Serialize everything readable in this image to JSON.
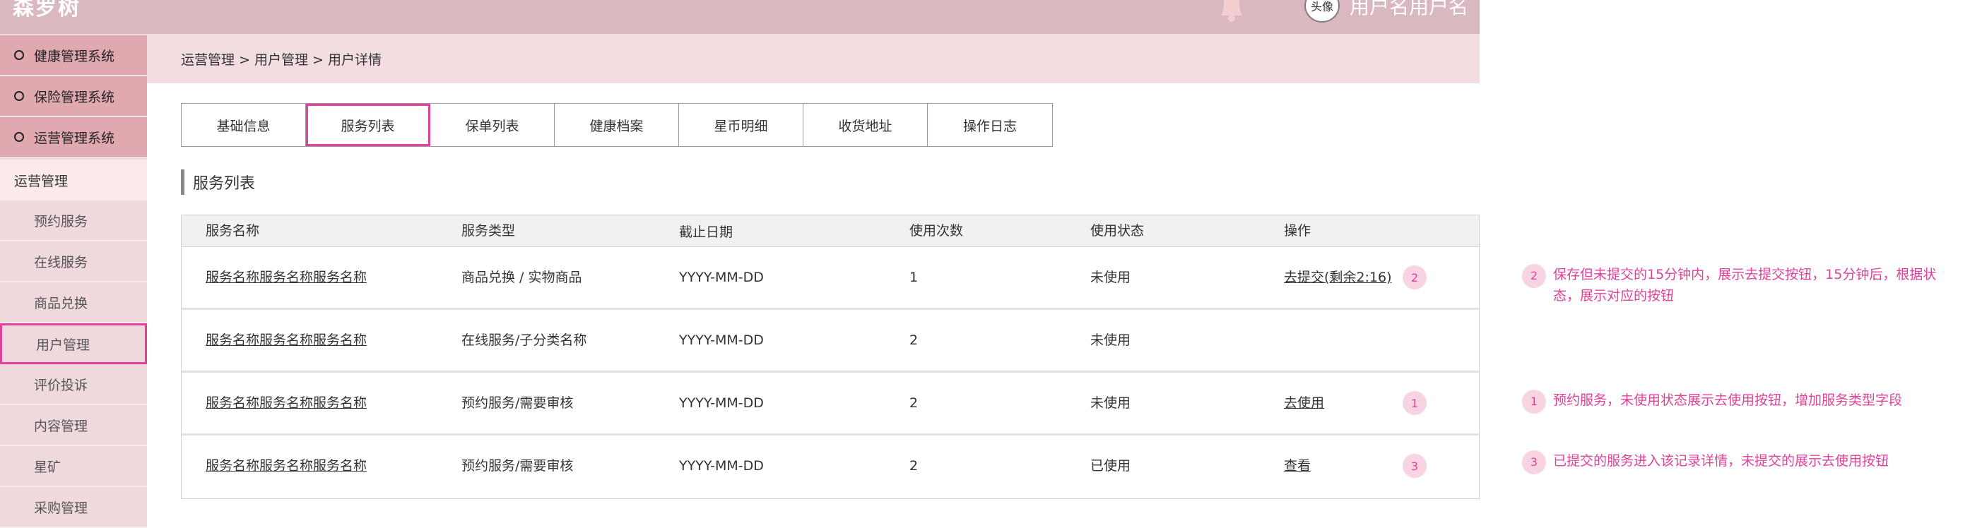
{
  "header": {
    "brand": "森罗树",
    "avatar_label": "头像",
    "username": "用户名用户名"
  },
  "sidebar": {
    "systems": [
      {
        "label": "健康管理系统"
      },
      {
        "label": "保险管理系统"
      },
      {
        "label": "运营管理系统"
      }
    ],
    "section": "运营管理",
    "items": [
      {
        "label": "预约服务"
      },
      {
        "label": "在线服务"
      },
      {
        "label": "商品兑换"
      },
      {
        "label": "用户管理"
      },
      {
        "label": "评价投诉"
      },
      {
        "label": "内容管理"
      },
      {
        "label": "星矿"
      },
      {
        "label": "采购管理"
      }
    ]
  },
  "breadcrumb": "运营管理 > 用户管理 > 用户详情",
  "tabs": [
    {
      "label": "基础信息"
    },
    {
      "label": "服务列表"
    },
    {
      "label": "保单列表"
    },
    {
      "label": "健康档案"
    },
    {
      "label": "星币明细"
    },
    {
      "label": "收货地址"
    },
    {
      "label": "操作日志"
    }
  ],
  "section_title": "服务列表",
  "table": {
    "headers": [
      "服务名称",
      "服务类型",
      "截止日期",
      "使用次数",
      "使用状态",
      "操作"
    ],
    "rows": [
      {
        "name": "服务名称服务名称服务名称",
        "type": "商品兑换 / 实物商品",
        "date": "YYYY-MM-DD",
        "count": "1",
        "status": "未使用",
        "action": "去提交",
        "action_suffix": "(剩余2:16)",
        "badge": "2"
      },
      {
        "name": "服务名称服务名称服务名称",
        "type": "在线服务/子分类名称",
        "date": "YYYY-MM-DD",
        "count": "2",
        "status": "未使用",
        "action": "",
        "action_suffix": "",
        "badge": ""
      },
      {
        "name": "服务名称服务名称服务名称",
        "type": "预约服务/需要审核",
        "date": "YYYY-MM-DD",
        "count": "2",
        "status": "未使用",
        "action": "去使用",
        "action_suffix": "",
        "badge": "1"
      },
      {
        "name": "服务名称服务名称服务名称",
        "type": "预约服务/需要审核",
        "date": "YYYY-MM-DD",
        "count": "2",
        "status": "已使用",
        "action": "查看",
        "action_suffix": "",
        "badge": "3"
      }
    ]
  },
  "annotations": [
    {
      "badge": "2",
      "text": "保存但未提交的15分钟内，展示去提交按钮，15分钟后，根据状态，展示对应的按钮"
    },
    {
      "badge": "1",
      "text": "预约服务，未使用状态展示去使用按钮，增加服务类型字段"
    },
    {
      "badge": "3",
      "text": "已提交的服务进入该记录详情，未提交的展示去使用按钮"
    }
  ],
  "colors": {
    "accent": "#e0419a",
    "topbar": "#d9b8bf",
    "sidebar": "#efd9dd",
    "sidebar_system": "#e0a9b0"
  }
}
